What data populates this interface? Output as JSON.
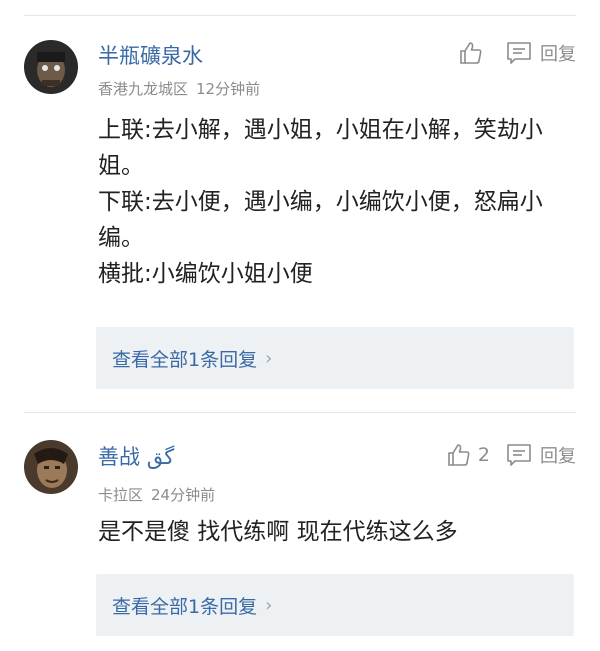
{
  "comments": [
    {
      "username": "半瓶礦泉水",
      "location": "香港九龙城区",
      "time": "12分钟前",
      "like_count": "",
      "reply_label": "回复",
      "body": "上联:去小解，遇小姐，小姐在小解，笑劫小姐。\n下联:去小便，遇小编，小编饮小便，怒扁小编。\n横批:小编饮小姐小便",
      "view_all_replies": "查看全部1条回复",
      "chevron": "›"
    },
    {
      "username": "善战 ﮔﻖ",
      "location": "卡拉区",
      "time": "24分钟前",
      "like_count": "2",
      "reply_label": "回复",
      "body": "是不是傻 找代练啊 现在代练这么多",
      "view_all_replies": "查看全部1条回复",
      "chevron": "›"
    }
  ],
  "icons": {
    "like": "thumbs-up-icon",
    "reply": "reply-icon"
  },
  "colors": {
    "username": "#3a6aa6",
    "meta": "#8c8c8c",
    "more_box_bg": "#eef1f4"
  }
}
